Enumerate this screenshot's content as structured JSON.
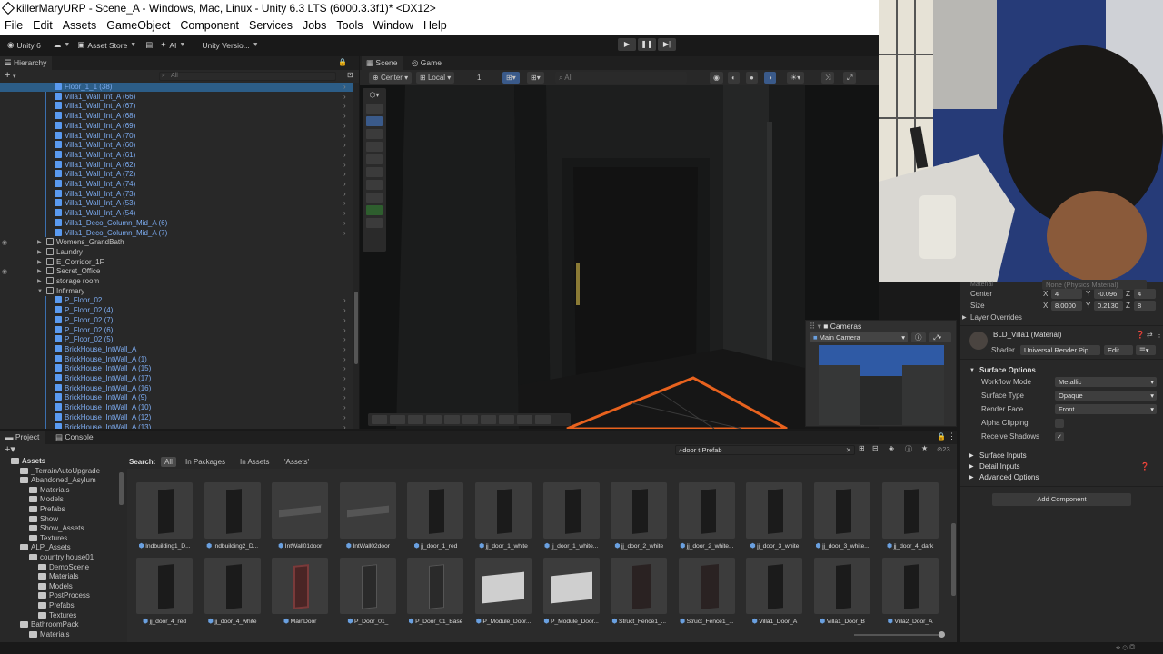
{
  "window": {
    "title": "killerMaryURP - Scene_A - Windows, Mac, Linux - Unity 6.3 LTS (6000.3.3f1)* <DX12>"
  },
  "menu": [
    "File",
    "Edit",
    "Assets",
    "GameObject",
    "Component",
    "Services",
    "Jobs",
    "Tools",
    "Window",
    "Help"
  ],
  "toolbar": {
    "account": "Unity 6",
    "asset_store": "Asset Store",
    "ai": "AI",
    "version": "Unity Versio..."
  },
  "hierarchy": {
    "tab": "Hierarchy",
    "search_placeholder": "All",
    "rows": [
      {
        "label": "Floor_1_1 (38)",
        "indent": 60,
        "prefab": true
      },
      {
        "label": "Villa1_Wall_Int_A (66)",
        "indent": 60,
        "prefab": true
      },
      {
        "label": "Villa1_Wall_Int_A (67)",
        "indent": 60,
        "prefab": true
      },
      {
        "label": "Villa1_Wall_Int_A (68)",
        "indent": 60,
        "prefab": true
      },
      {
        "label": "Villa1_Wall_Int_A (69)",
        "indent": 60,
        "prefab": true
      },
      {
        "label": "Villa1_Wall_Int_A (70)",
        "indent": 60,
        "prefab": true
      },
      {
        "label": "Villa1_Wall_Int_A (60)",
        "indent": 60,
        "prefab": true
      },
      {
        "label": "Villa1_Wall_Int_A (61)",
        "indent": 60,
        "prefab": true
      },
      {
        "label": "Villa1_Wall_Int_A (62)",
        "indent": 60,
        "prefab": true
      },
      {
        "label": "Villa1_Wall_Int_A (72)",
        "indent": 60,
        "prefab": true
      },
      {
        "label": "Villa1_Wall_Int_A (74)",
        "indent": 60,
        "prefab": true
      },
      {
        "label": "Villa1_Wall_Int_A (73)",
        "indent": 60,
        "prefab": true
      },
      {
        "label": "Villa1_Wall_Int_A (53)",
        "indent": 60,
        "prefab": true
      },
      {
        "label": "Villa1_Wall_Int_A (54)",
        "indent": 60,
        "prefab": true
      },
      {
        "label": "Villa1_Deco_Column_Mid_A (6)",
        "indent": 60,
        "prefab": true
      },
      {
        "label": "Villa1_Deco_Column_Mid_A (7)",
        "indent": 60,
        "prefab": true
      },
      {
        "label": "Womens_GrandBath",
        "indent": 51,
        "prefab": false
      },
      {
        "label": "Laundry",
        "indent": 51,
        "prefab": false
      },
      {
        "label": "E_Corridor_1F",
        "indent": 51,
        "prefab": false
      },
      {
        "label": "Secret_Office",
        "indent": 51,
        "prefab": false
      },
      {
        "label": "storage room",
        "indent": 51,
        "prefab": false
      },
      {
        "label": "Infirmary",
        "indent": 51,
        "prefab": false
      },
      {
        "label": "P_Floor_02",
        "indent": 60,
        "prefab": true
      },
      {
        "label": "P_Floor_02 (4)",
        "indent": 60,
        "prefab": true
      },
      {
        "label": "P_Floor_02 (7)",
        "indent": 60,
        "prefab": true
      },
      {
        "label": "P_Floor_02 (6)",
        "indent": 60,
        "prefab": true
      },
      {
        "label": "P_Floor_02 (5)",
        "indent": 60,
        "prefab": true
      },
      {
        "label": "BrickHouse_IntWall_A",
        "indent": 60,
        "prefab": true
      },
      {
        "label": "BrickHouse_IntWall_A (1)",
        "indent": 60,
        "prefab": true
      },
      {
        "label": "BrickHouse_IntWall_A (15)",
        "indent": 60,
        "prefab": true
      },
      {
        "label": "BrickHouse_IntWall_A (17)",
        "indent": 60,
        "prefab": true
      },
      {
        "label": "BrickHouse_IntWall_A (16)",
        "indent": 60,
        "prefab": true
      },
      {
        "label": "BrickHouse_IntWall_A (9)",
        "indent": 60,
        "prefab": true
      },
      {
        "label": "BrickHouse_IntWall_A (10)",
        "indent": 60,
        "prefab": true
      },
      {
        "label": "BrickHouse_IntWall_A (12)",
        "indent": 60,
        "prefab": true
      },
      {
        "label": "BrickHouse_IntWall_A (13)",
        "indent": 60,
        "prefab": true
      }
    ]
  },
  "scene": {
    "tab_scene": "Scene",
    "tab_game": "Game",
    "pivot": "Center",
    "space": "Local",
    "snap": "1",
    "search_placeholder": "All"
  },
  "cameras": {
    "title": "Cameras",
    "selected": "Main Camera"
  },
  "inspector": {
    "material_label": "Material",
    "material_value": "None (Physics Material)",
    "center_label": "Center",
    "center": {
      "x": "4",
      "y": "-0.096",
      "z": "4"
    },
    "size_label": "Size",
    "size": {
      "x": "8.0000",
      "y": "0.2130",
      "z": "8"
    },
    "layer_overrides": "Layer Overrides",
    "mat_name": "BLD_Villa1 (Material)",
    "shader_label": "Shader",
    "shader": "Universal Render Pip",
    "edit": "Edit...",
    "surface_options": "Surface Options",
    "workflow_label": "Workflow Mode",
    "workflow": "Metallic",
    "surface_type_label": "Surface Type",
    "surface_type": "Opaque",
    "render_face_label": "Render Face",
    "render_face": "Front",
    "alpha_label": "Alpha Clipping",
    "shadows_label": "Receive Shadows",
    "surface_inputs": "Surface Inputs",
    "detail_inputs": "Detail Inputs",
    "advanced": "Advanced Options",
    "add_component": "Add Component"
  },
  "project": {
    "tab_project": "Project",
    "tab_console": "Console",
    "search_value": "door t:Prefab",
    "count": "23",
    "search_label": "Search:",
    "filters": [
      "All",
      "In Packages",
      "In Assets",
      "'Assets'"
    ],
    "tree": [
      {
        "label": "Assets",
        "indent": 12,
        "bold": true
      },
      {
        "label": "_TerrainAutoUpgrade",
        "indent": 22
      },
      {
        "label": "Abandoned_Asylum",
        "indent": 22
      },
      {
        "label": "Materials",
        "indent": 32
      },
      {
        "label": "Models",
        "indent": 32
      },
      {
        "label": "Prefabs",
        "indent": 32
      },
      {
        "label": "Show",
        "indent": 32
      },
      {
        "label": "Show_Assets",
        "indent": 32
      },
      {
        "label": "Textures",
        "indent": 32
      },
      {
        "label": "ALP_Assets",
        "indent": 22
      },
      {
        "label": "country house01",
        "indent": 32
      },
      {
        "label": "DemoScene",
        "indent": 42
      },
      {
        "label": "Materials",
        "indent": 42
      },
      {
        "label": "Models",
        "indent": 42
      },
      {
        "label": "PostProcess",
        "indent": 42
      },
      {
        "label": "Prefabs",
        "indent": 42
      },
      {
        "label": "Textures",
        "indent": 42
      },
      {
        "label": "BathroomPack",
        "indent": 22
      },
      {
        "label": "Materials",
        "indent": 32
      }
    ],
    "assets_row1": [
      "Indbuilding1_D...",
      "Indbuilding2_D...",
      "IntWall01door",
      "IntWall02door",
      "jj_door_1_red",
      "jj_door_1_white",
      "jj_door_1_white...",
      "jj_door_2_white",
      "jj_door_2_white...",
      "jj_door_3_white",
      "jj_door_3_white...",
      "jj_door_4_dark"
    ],
    "assets_row2": [
      "jj_door_4_red",
      "jj_door_4_white",
      "MainDoor",
      "P_Door_01_",
      "P_Door_01_Base",
      "P_Module_Door...",
      "P_Module_Door...",
      "Struct_Fence1_...",
      "Struct_Fence1_...",
      "Villa1_Door_A",
      "Villa1_Door_B",
      "Villa2_Door_A"
    ]
  }
}
